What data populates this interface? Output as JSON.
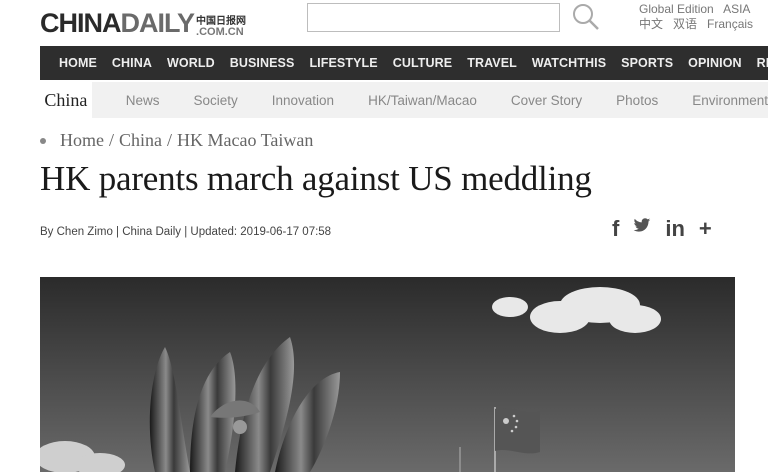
{
  "header": {
    "logo_main": "CHINA",
    "logo_accent": "DAILY",
    "logo_cn": "中国日报网",
    "logo_domain": ".COM.CN",
    "edition_label": "Global Edition",
    "edition_region": "ASIA",
    "languages": [
      "中文",
      "双语",
      "Français"
    ],
    "search_placeholder": ""
  },
  "nav": {
    "items": [
      "HOME",
      "CHINA",
      "WORLD",
      "BUSINESS",
      "LIFESTYLE",
      "CULTURE",
      "TRAVEL",
      "WATCHTHIS",
      "SPORTS",
      "OPINION",
      "REGIONS"
    ]
  },
  "subnav": {
    "title": "China",
    "items": [
      "News",
      "Society",
      "Innovation",
      "HK/Taiwan/Macao",
      "Cover Story",
      "Photos",
      "Environment"
    ]
  },
  "breadcrumb": {
    "items": [
      "Home",
      "China",
      "HK Macao Taiwan"
    ],
    "separator": "/"
  },
  "article": {
    "headline": "HK parents march against US meddling",
    "byline": "By Chen Zimo | China Daily | Updated: 2019-06-17 07:58"
  },
  "share": {
    "icons": [
      "facebook-icon",
      "twitter-icon",
      "linkedin-icon",
      "plus-icon"
    ],
    "facebook": "f",
    "linkedin": "in",
    "more": "+"
  }
}
